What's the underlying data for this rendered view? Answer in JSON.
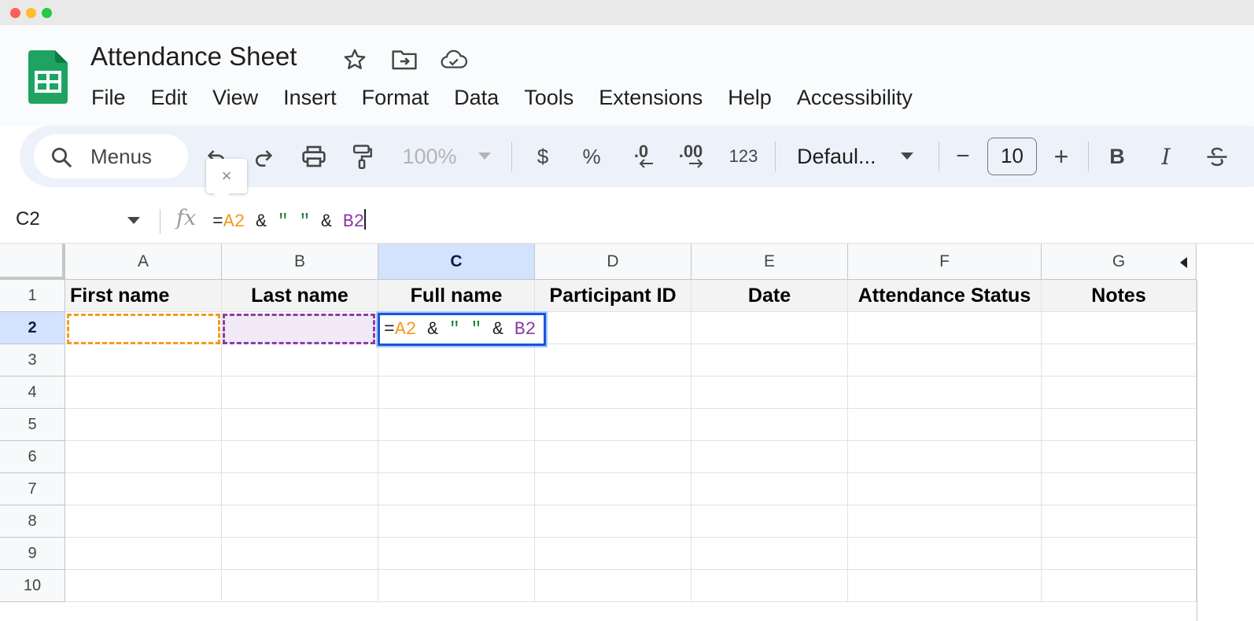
{
  "document": {
    "title": "Attendance Sheet"
  },
  "menus": [
    "File",
    "Edit",
    "View",
    "Insert",
    "Format",
    "Data",
    "Tools",
    "Extensions",
    "Help",
    "Accessibility"
  ],
  "toolbar": {
    "search_label": "Menus",
    "zoom": "100%",
    "currency": "$",
    "percent": "%",
    "decrease_decimal": ".0",
    "increase_decimal": ".00",
    "number_format": "123",
    "font": "Defaul...",
    "font_size": "10",
    "minus": "−",
    "plus": "+",
    "bold": "B",
    "italic": "I"
  },
  "tooltip": {
    "close": "×"
  },
  "formula_bar": {
    "name_box": "C2",
    "fx": "fx",
    "formula": {
      "eq": "=",
      "ref1": "A2",
      "amp1": " & ",
      "str": "\" \"",
      "amp2": " & ",
      "ref2": "B2"
    }
  },
  "grid": {
    "columns": [
      "A",
      "B",
      "C",
      "D",
      "E",
      "F",
      "G"
    ],
    "rows": [
      "1",
      "2",
      "3",
      "4",
      "5",
      "6",
      "7",
      "8",
      "9",
      "10"
    ],
    "header_row": [
      "First name",
      "Last name",
      "Full name",
      "Participant ID",
      "Date",
      "Attendance Status",
      "Notes"
    ],
    "active_cell": "C2"
  },
  "colors": {
    "ref_a": "#f39b1f",
    "ref_b": "#8b3da6",
    "string": "#188038",
    "selection": "#1a56db"
  }
}
